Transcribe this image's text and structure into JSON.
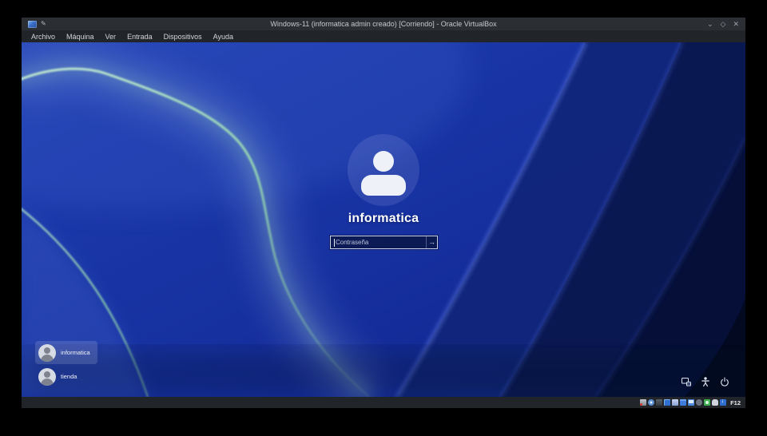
{
  "window": {
    "title": "Windows-11 (informatica admin creado) [Corriendo] - Oracle VirtualBox",
    "menu_items": [
      "Archivo",
      "Máquina",
      "Ver",
      "Entrada",
      "Dispositivos",
      "Ayuda"
    ],
    "controls": {
      "minimize": "⌄",
      "restore": "◇",
      "close": "✕"
    },
    "pencil_glyph": "✎"
  },
  "login": {
    "active_user": "informatica",
    "password": {
      "placeholder": "Contraseña",
      "value": ""
    },
    "submit_icon": "→",
    "users": [
      {
        "name": "informatica",
        "selected": true
      },
      {
        "name": "tienda",
        "selected": false
      }
    ],
    "quick_actions": [
      "network",
      "ease-of-access",
      "power"
    ]
  },
  "statusbar": {
    "icons": [
      "hard-disks",
      "optical-drives",
      "audio",
      "network",
      "usb",
      "shared-folders",
      "display",
      "recording",
      "features",
      "mouse-integration",
      "keyboard"
    ],
    "host_key": "F12"
  },
  "colors": {
    "wallpaper_base": "#1c38a9",
    "wallpaper_mint_edge": "#a9dfc0",
    "wallpaper_dark_navy": "#050d33",
    "titlebar_bg": "#2b2f34",
    "menubar_bg": "#212529",
    "selected_user_bg": "rgba(255,255,255,0.14)"
  }
}
